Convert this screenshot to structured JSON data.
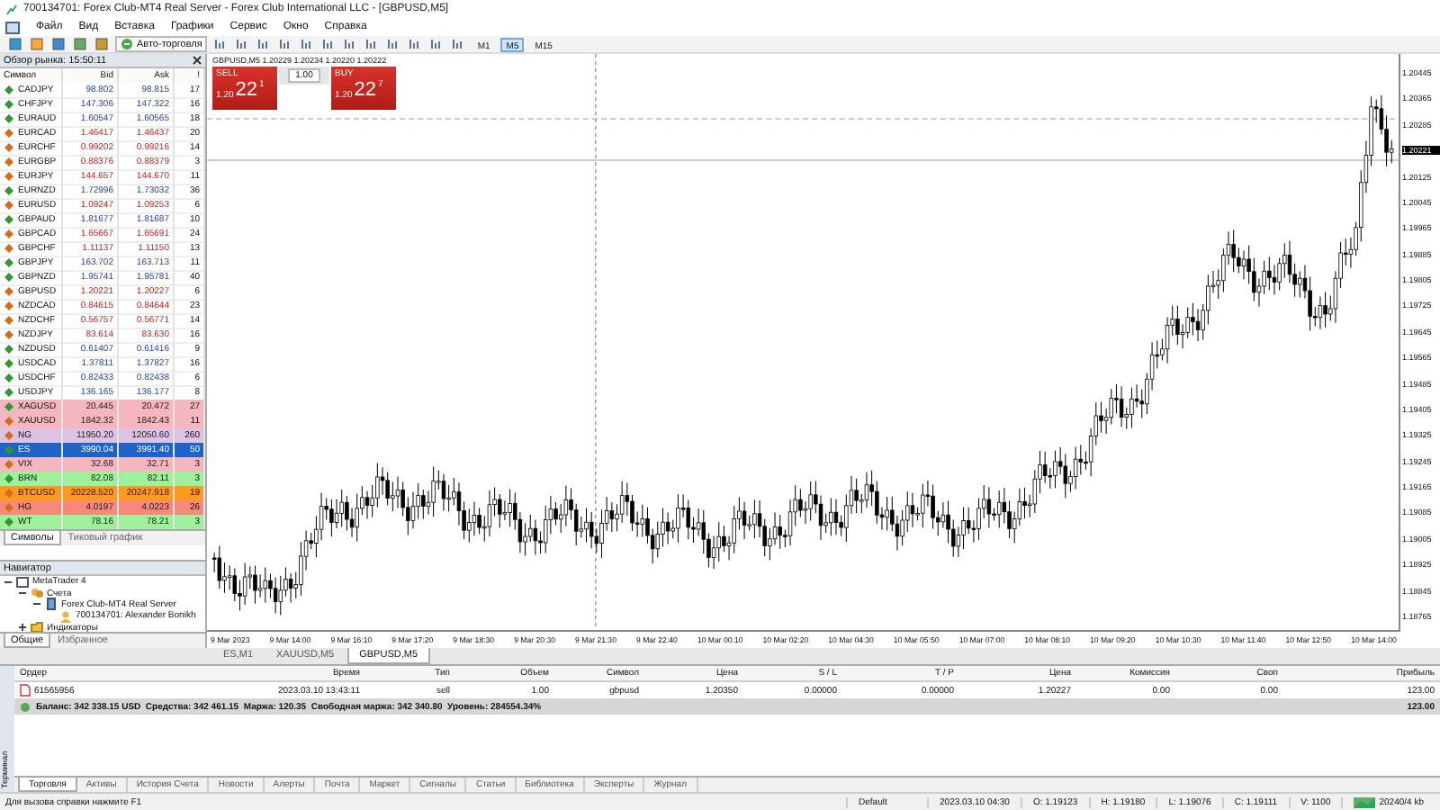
{
  "window": {
    "title": "700134701: Forex Club-MT4 Real Server - Forex Club International LLC - [GBPUSD,M5]"
  },
  "menu": [
    "Файл",
    "Вид",
    "Вставка",
    "Графики",
    "Сервис",
    "Окно",
    "Справка"
  ],
  "toolbar": {
    "autotrading": "Авто-торговля",
    "timeframes": [
      {
        "label": "M1",
        "selected": false
      },
      {
        "label": "M5",
        "selected": true
      },
      {
        "label": "M15",
        "selected": false
      }
    ]
  },
  "market_watch": {
    "title": "Обзор рынка: 15:50:11",
    "columns": [
      "Символ",
      "Bid",
      "Ask",
      "!"
    ],
    "rows": [
      {
        "symbol": "CADJPY",
        "bid": "98.802",
        "ask": "98.815",
        "spread": "17",
        "up": true,
        "selected": false
      },
      {
        "symbol": "CHFJPY",
        "bid": "147.306",
        "ask": "147.322",
        "spread": "16",
        "up": true,
        "selected": false
      },
      {
        "symbol": "EURAUD",
        "bid": "1.60547",
        "ask": "1.60565",
        "spread": "18",
        "up": true,
        "selected": false
      },
      {
        "symbol": "EURCAD",
        "bid": "1.46417",
        "ask": "1.46437",
        "spread": "20",
        "up": false,
        "selected": false
      },
      {
        "symbol": "EURCHF",
        "bid": "0.99202",
        "ask": "0.99216",
        "spread": "14",
        "up": false,
        "selected": false
      },
      {
        "symbol": "EURGBP",
        "bid": "0.88376",
        "ask": "0.88379",
        "spread": "3",
        "up": false,
        "selected": false
      },
      {
        "symbol": "EURJPY",
        "bid": "144.657",
        "ask": "144.670",
        "spread": "11",
        "up": false,
        "selected": false
      },
      {
        "symbol": "EURNZD",
        "bid": "1.72996",
        "ask": "1.73032",
        "spread": "36",
        "up": true,
        "selected": false
      },
      {
        "symbol": "EURUSD",
        "bid": "1.09247",
        "ask": "1.09253",
        "spread": "6",
        "up": false,
        "selected": false
      },
      {
        "symbol": "GBPAUD",
        "bid": "1.81677",
        "ask": "1.81687",
        "spread": "10",
        "up": true,
        "selected": false
      },
      {
        "symbol": "GBPCAD",
        "bid": "1.65667",
        "ask": "1.65691",
        "spread": "24",
        "up": false,
        "selected": false
      },
      {
        "symbol": "GBPCHF",
        "bid": "1.11137",
        "ask": "1.11150",
        "spread": "13",
        "up": false,
        "selected": false
      },
      {
        "symbol": "GBPJPY",
        "bid": "163.702",
        "ask": "163.713",
        "spread": "11",
        "up": true,
        "selected": false
      },
      {
        "symbol": "GBPNZD",
        "bid": "1.95741",
        "ask": "1.95781",
        "spread": "40",
        "up": true,
        "selected": false
      },
      {
        "symbol": "GBPUSD",
        "bid": "1.20221",
        "ask": "1.20227",
        "spread": "6",
        "up": false,
        "selected": false
      },
      {
        "symbol": "NZDCAD",
        "bid": "0.84615",
        "ask": "0.84644",
        "spread": "23",
        "up": false,
        "selected": false
      },
      {
        "symbol": "NZDCHF",
        "bid": "0.56757",
        "ask": "0.56771",
        "spread": "14",
        "up": false,
        "selected": false
      },
      {
        "symbol": "NZDJPY",
        "bid": "83.614",
        "ask": "83.630",
        "spread": "16",
        "up": false,
        "selected": false
      },
      {
        "symbol": "NZDUSD",
        "bid": "0.61407",
        "ask": "0.61416",
        "spread": "9",
        "up": true,
        "selected": false
      },
      {
        "symbol": "USDCAD",
        "bid": "1.37811",
        "ask": "1.37827",
        "spread": "16",
        "up": true,
        "selected": false
      },
      {
        "symbol": "USDCHF",
        "bid": "0.82433",
        "ask": "0.82438",
        "spread": "6",
        "up": true,
        "selected": false
      },
      {
        "symbol": "USDJPY",
        "bid": "136.165",
        "ask": "136.177",
        "spread": "8",
        "up": true,
        "selected": false
      },
      {
        "symbol": "XAGUSD",
        "bid": "20.445",
        "ask": "20.472",
        "spread": "27",
        "up": true,
        "color": "#f4b6bf",
        "selected": false
      },
      {
        "symbol": "XAUUSD",
        "bid": "1842.32",
        "ask": "1842.43",
        "spread": "11",
        "up": false,
        "color": "#f4b6bf",
        "selected": false
      },
      {
        "symbol": "NG",
        "bid": "11950.20",
        "ask": "12050.60",
        "spread": "260",
        "up": false,
        "color": "#dcc3e3",
        "selected": false
      },
      {
        "symbol": "ES",
        "bid": "3990.04",
        "ask": "3991.40",
        "spread": "50",
        "up": true,
        "selected": true
      },
      {
        "symbol": "VIX",
        "bid": "32.68",
        "ask": "32.71",
        "spread": "3",
        "up": false,
        "color": "#f4b6bf",
        "selected": false
      },
      {
        "symbol": "BRN",
        "bid": "82.08",
        "ask": "82.11",
        "spread": "3",
        "up": true,
        "color": "#9ef09a",
        "selected": false
      },
      {
        "symbol": "BTCUSD",
        "bid": "20228.520",
        "ask": "20247.918",
        "spread": "19",
        "up": false,
        "color": "#ff9a1e",
        "selected": false
      },
      {
        "symbol": "HG",
        "bid": "4.0197",
        "ask": "4.0223",
        "spread": "26",
        "up": false,
        "color": "#f58a7a",
        "selected": false
      },
      {
        "symbol": "WT",
        "bid": "78.16",
        "ask": "78.21",
        "spread": "3",
        "up": true,
        "color": "#9ef09a",
        "selected": false
      }
    ],
    "tabs": [
      {
        "label": "Символы",
        "selected": true
      },
      {
        "label": "Тиковый график",
        "selected": false
      }
    ]
  },
  "navigator": {
    "title": "Навигатор",
    "tree": [
      {
        "label": "MetaTrader 4",
        "expanded": true,
        "children": [
          {
            "label": "Счета",
            "expanded": true,
            "children": [
              {
                "label": "Forex Club-MT4 Real Server",
                "expanded": true,
                "children": [
                  {
                    "label": "700134701: Alexander Bonikh"
                  }
                ]
              }
            ]
          },
          {
            "label": "Индикаторы",
            "expanded": false
          }
        ]
      }
    ],
    "tabs": [
      {
        "label": "Общие",
        "selected": true
      },
      {
        "label": "Избранное",
        "selected": false
      }
    ]
  },
  "chart": {
    "header": "GBPUSD,M5  1.20229 1.20234 1.20220 1.20222",
    "trade_panel": {
      "sell": "SELL",
      "buy": "BUY",
      "volume": "1.00",
      "sell_price": {
        "prefix": "1.20",
        "pips": "22",
        "point": "1"
      },
      "buy_price": {
        "prefix": "1.20",
        "pips": "22",
        "point": "7"
      }
    },
    "price_axis": [
      {
        "text": "1.20445",
        "current": false
      },
      {
        "text": "1.20365",
        "current": false
      },
      {
        "text": "1.20285",
        "current": false
      },
      {
        "text": "1.20221",
        "current": true
      },
      {
        "text": "1.20125",
        "current": false
      },
      {
        "text": "1.20045",
        "current": false
      },
      {
        "text": "1.19965",
        "current": false
      },
      {
        "text": "1.19885",
        "current": false
      },
      {
        "text": "1.19805",
        "current": false
      },
      {
        "text": "1.19725",
        "current": false
      },
      {
        "text": "1.19645",
        "current": false
      },
      {
        "text": "1.19565",
        "current": false
      },
      {
        "text": "1.19485",
        "current": false
      },
      {
        "text": "1.19405",
        "current": false
      },
      {
        "text": "1.19325",
        "current": false
      },
      {
        "text": "1.19245",
        "current": false
      },
      {
        "text": "1.19165",
        "current": false
      },
      {
        "text": "1.19085",
        "current": false
      },
      {
        "text": "1.19005",
        "current": false
      },
      {
        "text": "1.18925",
        "current": false
      },
      {
        "text": "1.18845",
        "current": false
      },
      {
        "text": "1.18765",
        "current": false
      }
    ],
    "time_axis": [
      "9 Mar 2023",
      "9 Mar 14:00",
      "9 Mar 16:10",
      "9 Mar 17:20",
      "9 Mar 18:30",
      "9 Mar 20:30",
      "9 Mar 21:30",
      "9 Mar 22:40",
      "10 Mar 00:10",
      "10 Mar 02:20",
      "10 Mar 04:30",
      "10 Mar 05:50",
      "10 Mar 07:00",
      "10 Mar 08:10",
      "10 Mar 09:20",
      "10 Mar 10:30",
      "10 Mar 11:40",
      "10 Mar 12:50",
      "10 Mar 14:00"
    ]
  },
  "chart_tabs": [
    {
      "label": "ES,M1",
      "selected": false
    },
    {
      "label": "XAUUSD,M5",
      "selected": false
    },
    {
      "label": "GBPUSD,M5",
      "selected": true
    }
  ],
  "terminal": {
    "side_label": "Терминал",
    "columns": [
      "Ордер",
      "Время",
      "Тип",
      "Объем",
      "Символ",
      "Цена",
      "S / L",
      "T / P",
      "Цена",
      "Комиссия",
      "Своп",
      "Прибыль"
    ],
    "orders": [
      {
        "cells": [
          "61565956",
          "2023.03.10 13:43:11",
          "sell",
          "1.00",
          "gbpusd",
          "1.20350",
          "0.00000",
          "0.00000",
          "1.20227",
          "0.00",
          "0.00",
          "123.00"
        ]
      }
    ],
    "summary": {
      "text": "Баланс: 342 338.15 USD  Средства: 342 461.15  Маржа: 120.35  Свободная маржа: 342 340.80  Уровень: 284554.34%",
      "profit": "123.00"
    },
    "tabs": [
      {
        "label": "Торговля",
        "selected": true
      },
      {
        "label": "Активы",
        "selected": false
      },
      {
        "label": "История Счета",
        "selected": false
      },
      {
        "label": "Новости",
        "selected": false
      },
      {
        "label": "Алерты",
        "selected": false
      },
      {
        "label": "Почта",
        "selected": false
      },
      {
        "label": "Маркет",
        "selected": false
      },
      {
        "label": "Сигналы",
        "selected": false
      },
      {
        "label": "Статьи",
        "selected": false
      },
      {
        "label": "Библиотека",
        "selected": false
      },
      {
        "label": "Эксперты",
        "selected": false
      },
      {
        "label": "Журнал",
        "selected": false
      }
    ]
  },
  "status_bar": {
    "help": "Для вызова справки нажмите F1",
    "profile": "Default",
    "time": "2023.03.10 04:30",
    "open": "O: 1.19123",
    "high": "H: 1.19180",
    "low": "L: 1.19076",
    "close": "C: 1.19111",
    "volume": "V: 1100",
    "traffic": "20240/4 kb"
  }
}
